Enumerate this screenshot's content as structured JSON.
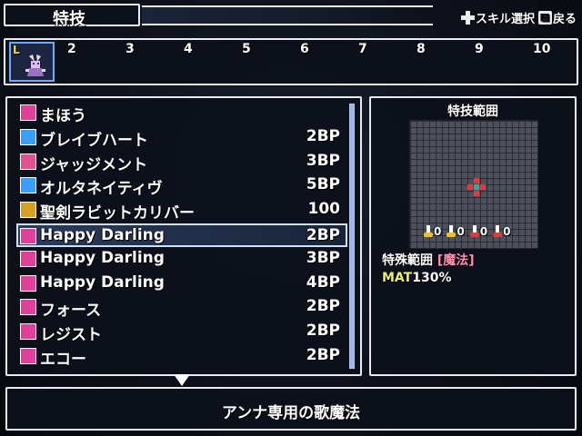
{
  "header": {
    "title": "特技",
    "hints": [
      {
        "icon": "dpad-icon",
        "label": "スキル選択"
      },
      {
        "icon": "cancel-button-icon",
        "glyph": "⊠",
        "label": "戻る"
      }
    ]
  },
  "party": {
    "selected_slot_label": "L",
    "slots": [
      "2",
      "3",
      "4",
      "5",
      "6",
      "7",
      "8",
      "9",
      "10"
    ]
  },
  "skills": [
    {
      "name": "まほう",
      "cost": "",
      "icon": "magic-category-icon",
      "color": "#e0409a"
    },
    {
      "name": "ブレイブハート",
      "cost": "2BP",
      "icon": "buff-skill-icon",
      "color": "#3aa0ff"
    },
    {
      "name": "ジャッジメント",
      "cost": "3BP",
      "icon": "attack-skill-icon",
      "color": "#e25090"
    },
    {
      "name": "オルタネイティヴ",
      "cost": "5BP",
      "icon": "special-skill-icon",
      "color": "#3aa0ff"
    },
    {
      "name": "聖剣ラビットカリバー",
      "cost": "100",
      "icon": "ultimate-skill-icon",
      "color": "#d8a020"
    },
    {
      "name": "Happy Darling",
      "cost": "2BP",
      "icon": "song-skill-icon",
      "color": "#e0409a",
      "selected": true
    },
    {
      "name": "Happy Darling",
      "cost": "3BP",
      "icon": "song-plus-skill-icon",
      "color": "#e0409a"
    },
    {
      "name": "Happy Darling",
      "cost": "4BP",
      "icon": "song-plus2-skill-icon",
      "color": "#e0409a"
    },
    {
      "name": "フォース",
      "cost": "2BP",
      "icon": "vocal-skill-icon",
      "color": "#e0409a"
    },
    {
      "name": "レジスト",
      "cost": "2BP",
      "icon": "vocal-skill-icon",
      "color": "#e0409a"
    },
    {
      "name": "エコー",
      "cost": "2BP",
      "icon": "vocal-skill-icon",
      "color": "#e0409a"
    }
  ],
  "range_panel": {
    "title": "特技範囲",
    "directions": [
      {
        "value": "0",
        "color": "#f0c020"
      },
      {
        "value": "0",
        "color": "#f0c020"
      },
      {
        "value": "0",
        "color": "#e23a3a"
      },
      {
        "value": "0",
        "color": "#e23a3a"
      }
    ],
    "special_label": "特殊範囲",
    "special_tag": "[魔法]",
    "stat_key": "MAT",
    "stat_value": "130%"
  },
  "description": "アンナ専用の歌魔法"
}
